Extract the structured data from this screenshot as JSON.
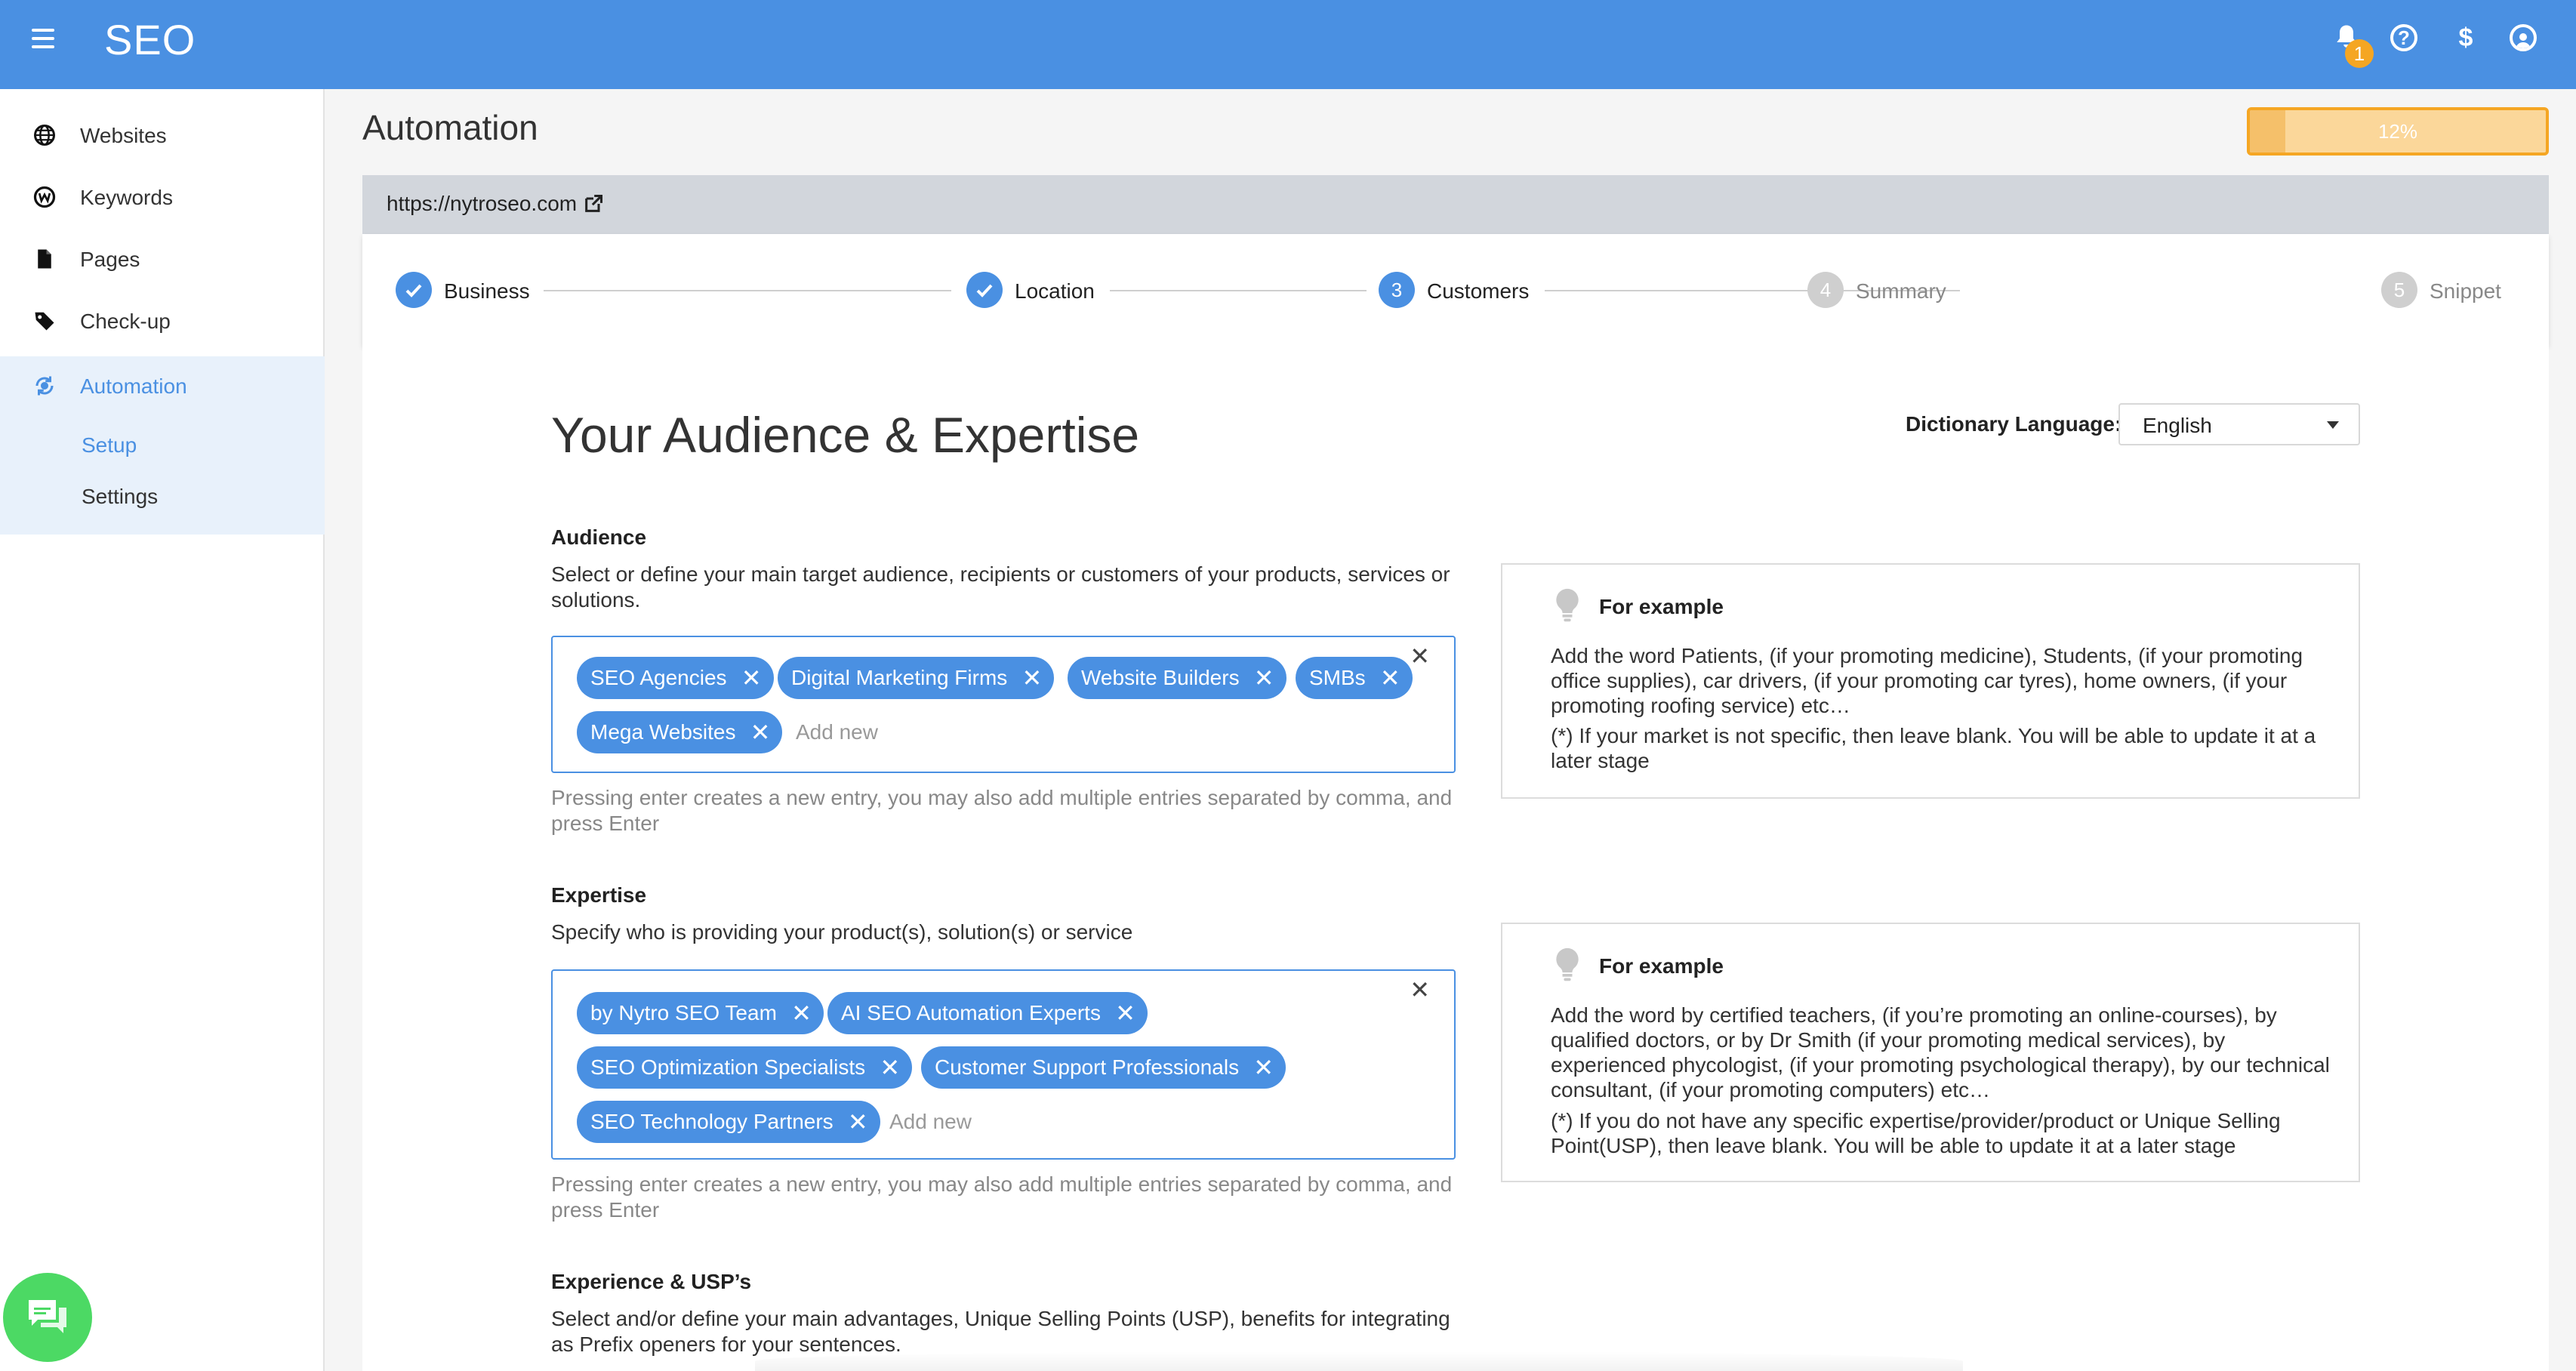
{
  "app": {
    "title": "SEO"
  },
  "topbar": {
    "notification_count": "1",
    "icons": [
      "menu-icon",
      "bell-icon",
      "help-icon",
      "dollar-icon",
      "account-icon"
    ]
  },
  "sidebar": {
    "items": [
      {
        "label": "Websites",
        "icon": "globe-icon"
      },
      {
        "label": "Keywords",
        "icon": "keyword-icon"
      },
      {
        "label": "Pages",
        "icon": "page-icon"
      },
      {
        "label": "Check-up",
        "icon": "tag-icon"
      },
      {
        "label": "Automation",
        "icon": "automation-icon"
      }
    ],
    "subitems": [
      {
        "label": "Setup"
      },
      {
        "label": "Settings"
      }
    ]
  },
  "page": {
    "title": "Automation"
  },
  "progress": {
    "label": "12%",
    "value": 0.12
  },
  "url": "https://nytroseo.com",
  "steps": [
    {
      "number": "1",
      "label": "Business",
      "done": true
    },
    {
      "number": "2",
      "label": "Location",
      "done": true
    },
    {
      "number": "3",
      "label": "Customers",
      "active": true
    },
    {
      "number": "4",
      "label": "Summary"
    },
    {
      "number": "5",
      "label": "Snippet"
    }
  ],
  "main": {
    "heading": "Your Audience & Expertise",
    "dictionary_label": "Dictionary Language:",
    "dictionary_value": "English"
  },
  "audience": {
    "title": "Audience",
    "description": "Select or define your main target audience, recipients or customers of your products, services or solutions.",
    "tags": [
      "SEO Agencies",
      "Digital Marketing Firms",
      "Website Builders",
      "SMBs",
      "Mega Websites"
    ],
    "placeholder": "Add new",
    "hint": "Pressing enter creates a new entry, you may also add multiple entries separated by comma, and press Enter",
    "example_title": "For example",
    "example_text": "Add the word Patients, (if your promoting medicine), Students, (if your promoting office supplies), car drivers, (if your promoting car tyres), home owners, (if your promoting roofing service) etc…",
    "example_note": "(*) If your market is not specific, then leave blank. You will be able to update it at a later stage"
  },
  "expertise": {
    "title": "Expertise",
    "description": "Specify who is providing your product(s), solution(s) or service",
    "tags": [
      "by Nytro SEO Team",
      "AI SEO Automation Experts",
      "SEO Optimization Specialists",
      "Customer Support Professionals",
      "SEO Technology Partners"
    ],
    "placeholder": "Add new",
    "hint": "Pressing enter creates a new entry, you may also add multiple entries separated by comma, and press Enter",
    "example_title": "For example",
    "example_text": "Add the word by certified teachers, (if you’re promoting an online-courses), by qualified doctors, or by Dr Smith (if your promoting medical services), by experienced phycologist, (if your promoting psychological therapy), by our technical consultant, (if your promoting computers) etc…",
    "example_note": "(*) If you do not have any specific expertise/provider/product or Unique Selling Point(USP), then leave blank. You will be able to update it at a later stage"
  },
  "experience": {
    "title": "Experience & USP’s",
    "description": "Select and/or define your main advantages, Unique Selling Points (USP), benefits for integrating as Prefix openers for your sentences."
  },
  "colors": {
    "accent": "#4a90e2",
    "warning": "#f5a623",
    "chat": "#4cd964"
  }
}
